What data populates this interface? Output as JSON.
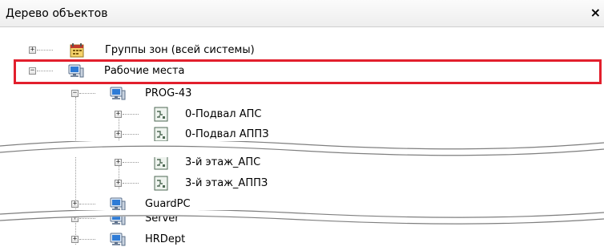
{
  "header": {
    "title": "Дерево объектов",
    "close": "×"
  },
  "tree": {
    "zone_groups": {
      "label": "Группы зон (всей системы)",
      "toggle": "+"
    },
    "workplaces": {
      "label": "Рабочие места",
      "toggle": "−"
    },
    "prog43": {
      "label": "PROG-43",
      "toggle": "−"
    },
    "podval_aps": {
      "label": "0-Подвал АПС",
      "toggle": "+"
    },
    "podval_appz": {
      "label": "0-Подвал АППЗ",
      "toggle": "+"
    },
    "floor3_aps": {
      "label": "3-й этаж_АПС",
      "toggle": "+"
    },
    "floor3_appz": {
      "label": "3-й этаж_АППЗ",
      "toggle": "+"
    },
    "guardpc": {
      "label": "GuardPC",
      "toggle": "+"
    },
    "server": {
      "label": "Server",
      "toggle": "+"
    },
    "hrdept": {
      "label": "HRDept",
      "toggle": "+"
    }
  },
  "colors": {
    "highlight": "#e21f2d",
    "monitor": "#2e7bd6"
  }
}
